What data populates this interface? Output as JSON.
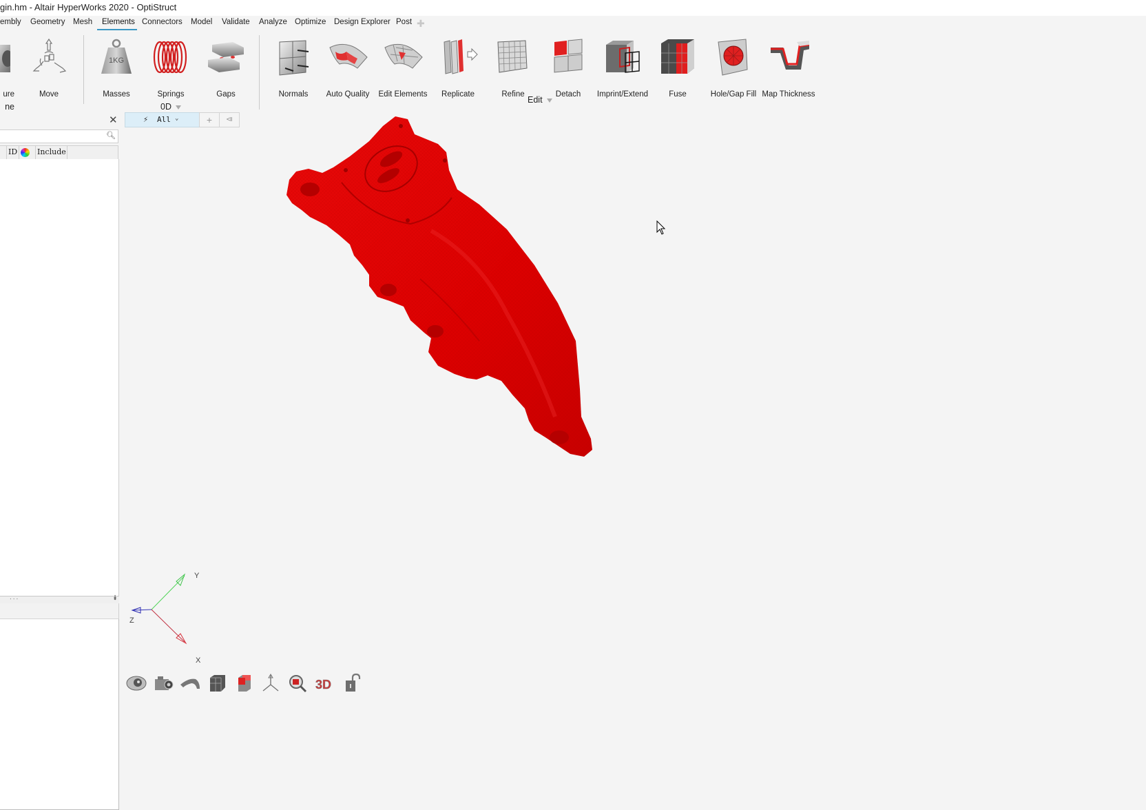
{
  "window": {
    "title": "gin.hm - Altair HyperWorks 2020 - OptiStruct"
  },
  "menubar": {
    "items": [
      {
        "label": "embly"
      },
      {
        "label": "Geometry"
      },
      {
        "label": "Mesh"
      },
      {
        "label": "Elements",
        "active": true
      },
      {
        "label": "Connectors"
      },
      {
        "label": "Model"
      },
      {
        "label": "Validate"
      },
      {
        "label": "Analyze"
      },
      {
        "label": "Optimize"
      },
      {
        "label": "Design Explorer"
      },
      {
        "label": "Post"
      }
    ],
    "add_tab_icon": "plus-icon",
    "accent_color": "#3a97c4"
  },
  "ribbon": {
    "tools": [
      {
        "label": "ure",
        "sublabel": "ne",
        "icon": "feature-icon"
      },
      {
        "label": "Move",
        "icon": "move-icon"
      },
      {
        "label": "Masses",
        "icon": "mass-weight-icon",
        "icon_text": "1KG"
      },
      {
        "label": "Springs",
        "icon": "spring-icon"
      },
      {
        "label": "Gaps",
        "icon": "gap-icon"
      },
      {
        "label": "Normals",
        "icon": "normals-icon"
      },
      {
        "label": "Auto Quality",
        "icon": "auto-quality-icon"
      },
      {
        "label": "Edit Elements",
        "icon": "edit-elements-icon"
      },
      {
        "label": "Replicate",
        "icon": "replicate-icon"
      },
      {
        "label": "Refine",
        "icon": "refine-icon"
      },
      {
        "label": "Detach",
        "icon": "detach-icon"
      },
      {
        "label": "Imprint/Extend",
        "icon": "imprint-extend-icon"
      },
      {
        "label": "Fuse",
        "icon": "fuse-icon"
      },
      {
        "label": "Hole/Gap Fill",
        "icon": "hole-gap-fill-icon"
      },
      {
        "label": "Map Thickness",
        "icon": "map-thickness-icon"
      }
    ],
    "groups": {
      "zero_d": "0D",
      "edit": "Edit"
    }
  },
  "browser": {
    "close_icon": "close-icon",
    "search": {
      "value": "",
      "placeholder": ""
    },
    "columns": [
      "ID",
      "color-wheel",
      "Include"
    ],
    "rows": [],
    "splitter_dots": "...",
    "expand_icon": "double-chevron-down-icon"
  },
  "filterbar": {
    "active_filter": "All",
    "add_icon": "plus-icon",
    "first_icon": "skip-first-icon"
  },
  "viewport": {
    "model_color": "#e00000",
    "axes": {
      "x": "X",
      "y": "Y",
      "z": "Z"
    },
    "axis_colors": {
      "x": "#d8303a",
      "y": "#3ec24a",
      "z": "#2a2ab0"
    }
  },
  "bottom_toolbar": {
    "icons": [
      "visibility-eye-icon",
      "camera-icon",
      "surface-icon",
      "solid-cube-icon",
      "element-cube-icon",
      "axis-triad-icon",
      "zoom-magnifier-icon",
      "3d-view-icon",
      "unlock-icon"
    ]
  }
}
